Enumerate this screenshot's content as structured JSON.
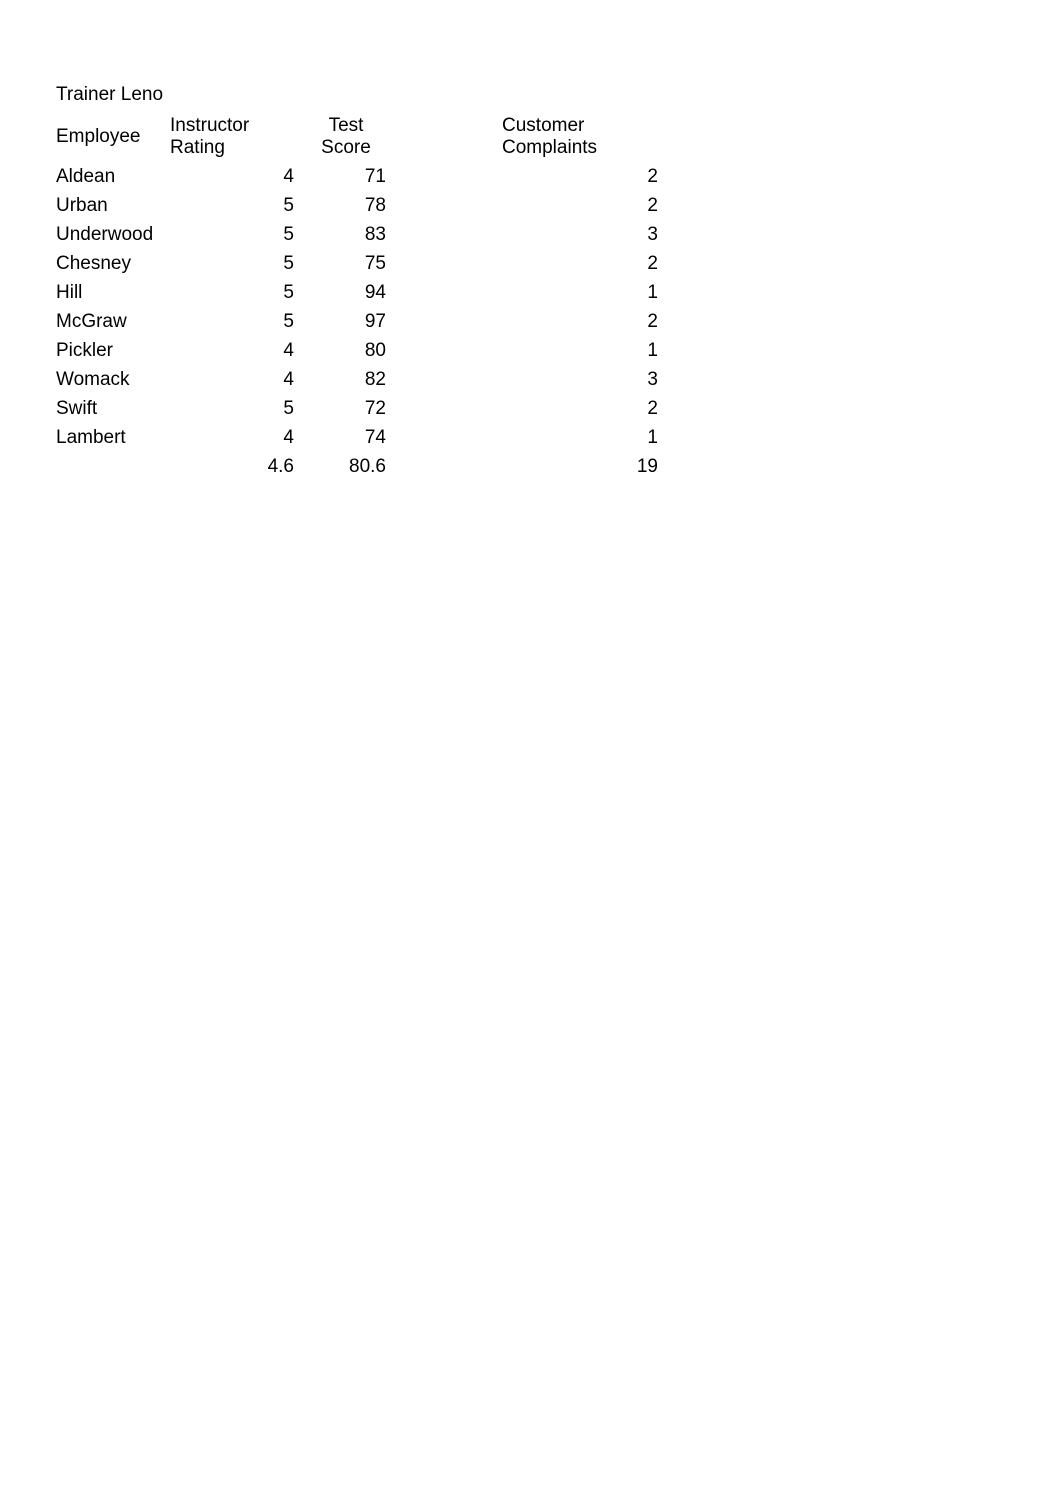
{
  "title": "Trainer Leno",
  "headers": {
    "employee": "Employee",
    "rating": "Instructor Rating",
    "score": "Test Score",
    "complaints": "Customer Complaints"
  },
  "rows": [
    {
      "employee": "Aldean",
      "rating": 4,
      "score": 71,
      "complaints": 2
    },
    {
      "employee": "Urban",
      "rating": 5,
      "score": 78,
      "complaints": 2
    },
    {
      "employee": "Underwood",
      "rating": 5,
      "score": 83,
      "complaints": 3
    },
    {
      "employee": "Chesney",
      "rating": 5,
      "score": 75,
      "complaints": 2
    },
    {
      "employee": "Hill",
      "rating": 5,
      "score": 94,
      "complaints": 1
    },
    {
      "employee": "McGraw",
      "rating": 5,
      "score": 97,
      "complaints": 2
    },
    {
      "employee": "Pickler",
      "rating": 4,
      "score": 80,
      "complaints": 1
    },
    {
      "employee": "Womack",
      "rating": 4,
      "score": 82,
      "complaints": 3
    },
    {
      "employee": "Swift",
      "rating": 5,
      "score": 72,
      "complaints": 2
    },
    {
      "employee": "Lambert",
      "rating": 4,
      "score": 74,
      "complaints": 1
    }
  ],
  "summary": {
    "rating": 4.6,
    "score": 80.6,
    "complaints": 19
  }
}
